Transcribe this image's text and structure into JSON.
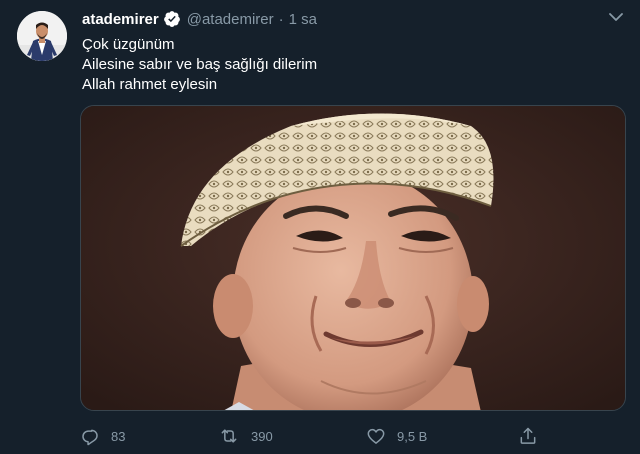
{
  "tweet": {
    "display_name": "atademirer",
    "handle": "@atademirer",
    "separator": "·",
    "time": "1 sa",
    "lines": [
      "Çok üzgünüm",
      "Ailesine sabır ve baş sağlığı dilerim",
      "Allah rahmet eylesin"
    ]
  },
  "actions": {
    "reply_count": "83",
    "retweet_count": "390",
    "like_count": "9,5 B"
  },
  "icons": {
    "verified": "verified-badge-icon",
    "more": "chevron-down-icon",
    "reply": "reply-icon",
    "retweet": "retweet-icon",
    "like": "heart-icon",
    "share": "share-icon"
  },
  "colors": {
    "background": "#15202b",
    "text_primary": "#ffffff",
    "text_secondary": "#8899a6",
    "verified": "#ffffff"
  }
}
